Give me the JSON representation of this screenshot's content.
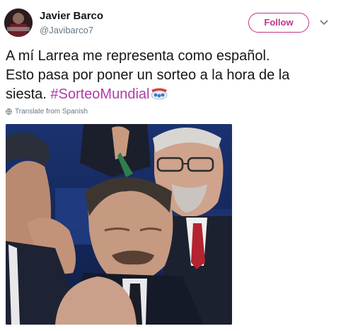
{
  "author": {
    "name": "Javier Barco",
    "handle": "@Javibarco7"
  },
  "follow_label": "Follow",
  "tweet": {
    "line1": "A mí Larrea me representa como español.",
    "line2": "Esto pasa por poner un sorteo a la hora de la",
    "line3_text": "siesta. ",
    "hashtag": "#SorteoMundial"
  },
  "translate_label": "Translate from Spanish",
  "icons": {
    "menu": "chevron-down-icon",
    "translate": "globe-icon",
    "emoji": "world-cup-draw-pot-icon"
  },
  "colors": {
    "accent": "#c13584",
    "hashtag": "#b03ba7",
    "muted": "#657786"
  }
}
